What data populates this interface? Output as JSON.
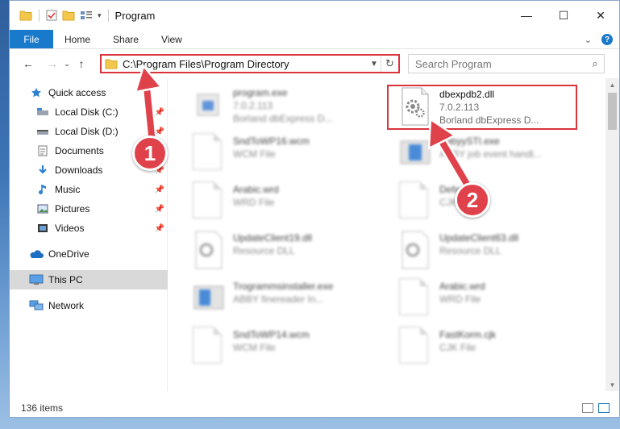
{
  "window": {
    "title": "Program",
    "controls": {
      "minimize": "—",
      "maximize": "☐",
      "close": "✕"
    }
  },
  "ribbon": {
    "tabs": [
      "File",
      "Home",
      "Share",
      "View"
    ],
    "expand_icon": "chevron-down-icon",
    "help_label": "?"
  },
  "navbar": {
    "address_path": "C:\\Program Files\\Program Directory",
    "search_placeholder": "Search Program"
  },
  "sidebar": {
    "items": [
      {
        "label": "Quick access",
        "icon": "star-icon",
        "pinned": false
      },
      {
        "label": "Local Disk (C:)",
        "icon": "drive-icon",
        "pinned": true
      },
      {
        "label": "Local Disk (D:)",
        "icon": "drive-icon",
        "pinned": true
      },
      {
        "label": "Documents",
        "icon": "documents-icon",
        "pinned": true
      },
      {
        "label": "Downloads",
        "icon": "download-icon",
        "pinned": true
      },
      {
        "label": "Music",
        "icon": "music-icon",
        "pinned": true
      },
      {
        "label": "Pictures",
        "icon": "pictures-icon",
        "pinned": true
      },
      {
        "label": "Videos",
        "icon": "videos-icon",
        "pinned": true
      },
      {
        "label": "OneDrive",
        "icon": "cloud-icon",
        "pinned": false
      },
      {
        "label": "This PC",
        "icon": "computer-icon",
        "pinned": false,
        "selected": true
      },
      {
        "label": "Network",
        "icon": "network-icon",
        "pinned": false
      }
    ]
  },
  "files": [
    {
      "name": "program.exe",
      "line2": "7.0.2.113",
      "line3": "Borland dbExpress D...",
      "blurred": true
    },
    {
      "name": "dbexpdb2.dll",
      "line2": "7.0.2.113",
      "line3": "Borland dbExpress D...",
      "blurred": false,
      "highlighted": true
    },
    {
      "name": "SndToWP16.wcm",
      "line2": "WCM File",
      "blurred": true
    },
    {
      "name": "AbbyySTI.exe",
      "line2": "ABBY job event handl...",
      "blurred": true
    },
    {
      "name": "Arabic.wrd",
      "line2": "WRD File",
      "blurred": true
    },
    {
      "name": "Default.cjk",
      "line2": "CJK File",
      "blurred": true
    },
    {
      "name": "UpdateClient19.dll",
      "line2": "Resource DLL",
      "blurred": true
    },
    {
      "name": "UpdateClient63.dll",
      "line2": "Resource DLL",
      "blurred": true
    },
    {
      "name": "Trogrammsinstaller.exe",
      "line2": "ABBY finereader In...",
      "blurred": true
    },
    {
      "name": "Arabic.wrd",
      "line2": "WRD File",
      "blurred": true
    },
    {
      "name": "SndToWP14.wcm",
      "line2": "WCM File",
      "blurred": true
    },
    {
      "name": "FastKorm.cjk",
      "line2": "CJK File",
      "blurred": true
    }
  ],
  "status": {
    "item_count": "136 items"
  },
  "annotations": {
    "badge1": "1",
    "badge2": "2"
  },
  "colors": {
    "accent": "#1979ca",
    "highlight": "#d9343c",
    "badge": "#e0424b"
  }
}
